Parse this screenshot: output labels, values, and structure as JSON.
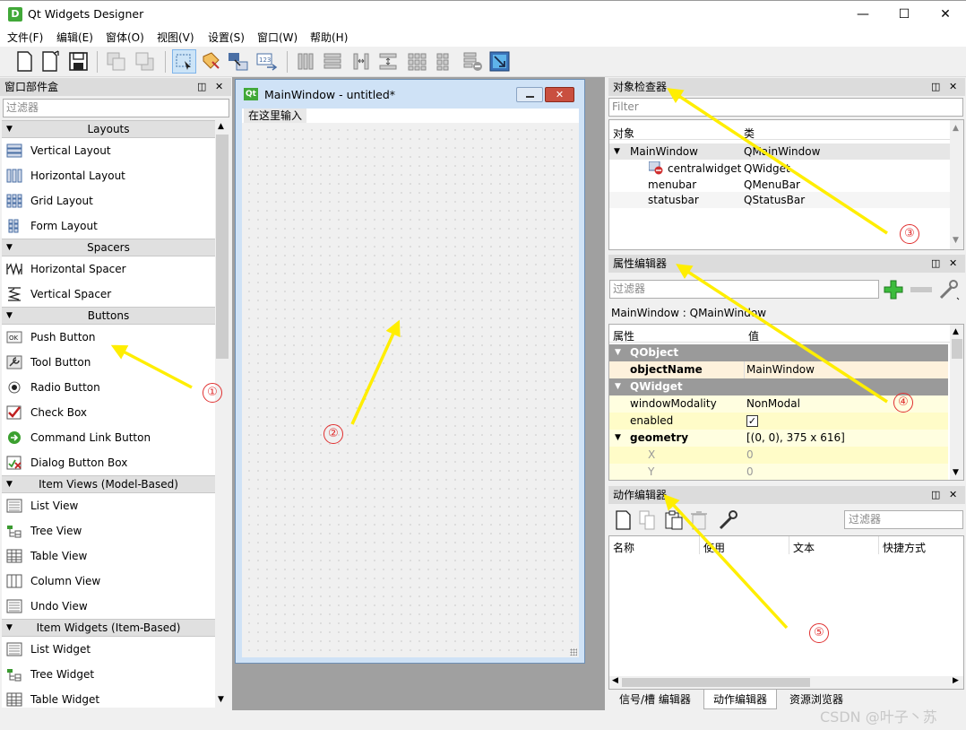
{
  "window": {
    "title": "Qt Widgets Designer",
    "icon_letter": "D"
  },
  "menu": [
    "文件(F)",
    "编辑(E)",
    "窗体(O)",
    "视图(V)",
    "设置(S)",
    "窗口(W)",
    "帮助(H)"
  ],
  "widget_box": {
    "title": "窗口部件盒",
    "filter_placeholder": "过滤器",
    "categories": [
      {
        "name": "Layouts",
        "items": [
          "Vertical Layout",
          "Horizontal Layout",
          "Grid Layout",
          "Form Layout"
        ]
      },
      {
        "name": "Spacers",
        "items": [
          "Horizontal Spacer",
          "Vertical Spacer"
        ]
      },
      {
        "name": "Buttons",
        "items": [
          "Push Button",
          "Tool Button",
          "Radio Button",
          "Check Box",
          "Command Link Button",
          "Dialog Button Box"
        ]
      },
      {
        "name": "Item Views (Model-Based)",
        "items": [
          "List View",
          "Tree View",
          "Table View",
          "Column View",
          "Undo View"
        ]
      },
      {
        "name": "Item Widgets (Item-Based)",
        "items": [
          "List Widget",
          "Tree Widget",
          "Table Widget"
        ]
      }
    ]
  },
  "form": {
    "title": "MainWindow - untitled*",
    "menu_placeholder": "在这里输入"
  },
  "object_inspector": {
    "title": "对象检查器",
    "filter_placeholder": "Filter",
    "col_object": "对象",
    "col_class": "类",
    "rows": [
      {
        "object": "MainWindow",
        "class": "QMainWindow"
      },
      {
        "object": "centralwidget",
        "class": "QWidget"
      },
      {
        "object": "menubar",
        "class": "QMenuBar"
      },
      {
        "object": "statusbar",
        "class": "QStatusBar"
      }
    ]
  },
  "property_editor": {
    "title": "属性编辑器",
    "filter_placeholder": "过滤器",
    "context": "MainWindow : QMainWindow",
    "col_property": "属性",
    "col_value": "值",
    "group_qobject": "QObject",
    "group_qwidget": "QWidget",
    "props": {
      "objectName": {
        "name": "objectName",
        "value": "MainWindow"
      },
      "windowModality": {
        "name": "windowModality",
        "value": "NonModal"
      },
      "enabled": {
        "name": "enabled",
        "checked": true
      },
      "geometry": {
        "name": "geometry",
        "value": "[(0, 0), 375 x 616]"
      },
      "x": {
        "name": "X",
        "value": "0"
      },
      "y": {
        "name": "Y",
        "value": "0"
      }
    }
  },
  "action_editor": {
    "title": "动作编辑器",
    "filter_placeholder": "过滤器",
    "columns": [
      "名称",
      "使用",
      "文本",
      "快捷方式"
    ]
  },
  "bottom_tabs": [
    "信号/槽 编辑器",
    "动作编辑器",
    "资源浏览器"
  ],
  "annotations": [
    "①",
    "②",
    "③",
    "④",
    "⑤"
  ],
  "watermark": "CSDN @叶子丶苏",
  "colors": {
    "arrow": "#ffee00",
    "marker": "#e03030",
    "group_header": "#9a9a9a",
    "selected_row": "#fdf1dc",
    "row_yellow": "#fffee0"
  }
}
